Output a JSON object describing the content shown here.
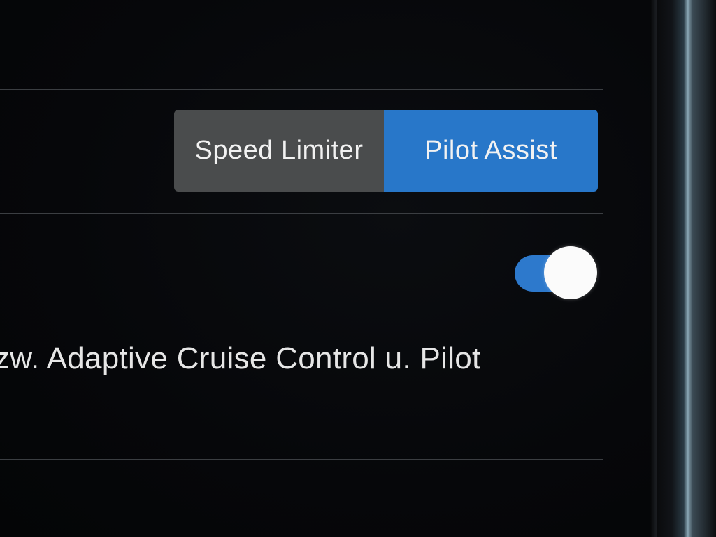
{
  "mode_selector": {
    "speed_limiter_label": "Speed Limiter",
    "pilot_assist_label": "Pilot Assist",
    "selected": "Pilot Assist"
  },
  "toggle": {
    "state": "on",
    "accent_color": "#2d79cc"
  },
  "description_text": "zw. Adaptive Cruise Control u. Pilot",
  "colors": {
    "background": "#050608",
    "selected_segment": "#2877c9",
    "unselected_segment": "#4a4c4d",
    "divider": "#3b3e42",
    "text": "#f2f2f2"
  }
}
